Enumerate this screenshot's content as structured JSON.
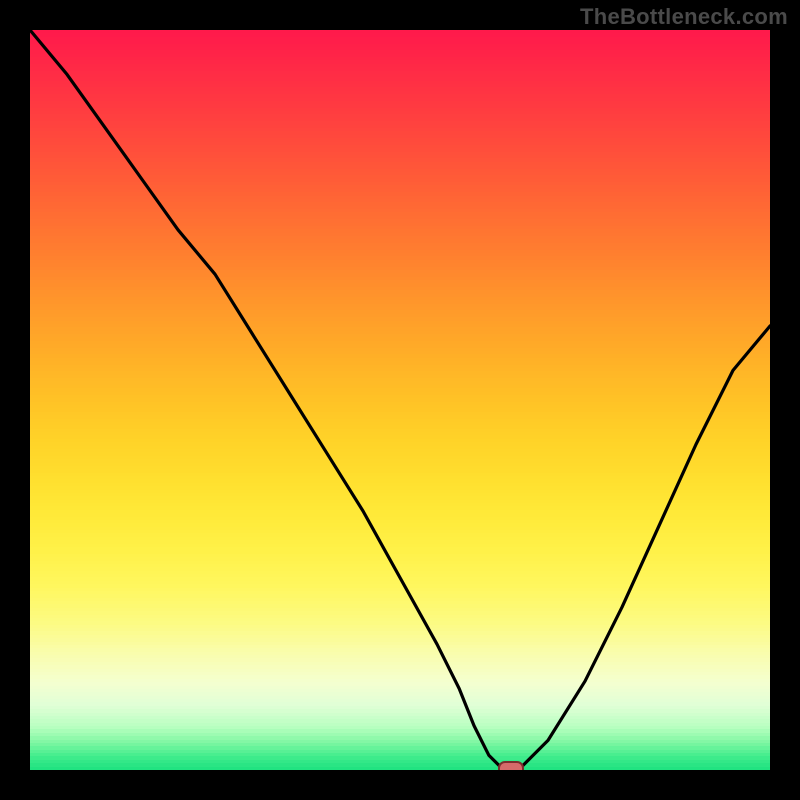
{
  "watermark": "TheBottleneck.com",
  "colors": {
    "black": "#000000",
    "curve": "#000000",
    "marker_fill": "#d66a6a",
    "marker_border": "#7a2e2e"
  },
  "chart_data": {
    "type": "line",
    "title": "",
    "xlabel": "",
    "ylabel": "",
    "xlim": [
      0,
      100
    ],
    "ylim": [
      0,
      100
    ],
    "series": [
      {
        "name": "bottleneck-curve",
        "x": [
          0,
          5,
          10,
          15,
          20,
          25,
          30,
          35,
          40,
          45,
          50,
          55,
          58,
          60,
          62,
          64,
          66,
          70,
          75,
          80,
          85,
          90,
          95,
          100
        ],
        "y": [
          100,
          94,
          87,
          80,
          73,
          67,
          59,
          51,
          43,
          35,
          26,
          17,
          11,
          6,
          2,
          0,
          0,
          4,
          12,
          22,
          33,
          44,
          54,
          60
        ]
      }
    ],
    "marker": {
      "x": 65,
      "y": 0
    },
    "gradient_stops": [
      {
        "p": 0.0,
        "c": "#ff1a4b"
      },
      {
        "p": 0.05,
        "c": "#ff2a46"
      },
      {
        "p": 0.1,
        "c": "#ff3a41"
      },
      {
        "p": 0.15,
        "c": "#ff4b3c"
      },
      {
        "p": 0.2,
        "c": "#ff5c37"
      },
      {
        "p": 0.25,
        "c": "#ff6e33"
      },
      {
        "p": 0.3,
        "c": "#ff7f2f"
      },
      {
        "p": 0.35,
        "c": "#ff912c"
      },
      {
        "p": 0.4,
        "c": "#ffa229"
      },
      {
        "p": 0.45,
        "c": "#ffb327"
      },
      {
        "p": 0.5,
        "c": "#ffc326"
      },
      {
        "p": 0.55,
        "c": "#ffd228"
      },
      {
        "p": 0.6,
        "c": "#ffde2e"
      },
      {
        "p": 0.65,
        "c": "#ffe938"
      },
      {
        "p": 0.7,
        "c": "#fff148"
      },
      {
        "p": 0.75,
        "c": "#fff75f"
      },
      {
        "p": 0.8,
        "c": "#fcfb84"
      },
      {
        "p": 0.84,
        "c": "#f9fdad"
      },
      {
        "p": 0.88,
        "c": "#f4ffd0"
      },
      {
        "p": 0.91,
        "c": "#e0ffd6"
      },
      {
        "p": 0.94,
        "c": "#b8ffc0"
      },
      {
        "p": 0.96,
        "c": "#80f7a3"
      },
      {
        "p": 0.98,
        "c": "#40ec8c"
      },
      {
        "p": 1.0,
        "c": "#18e07e"
      }
    ]
  }
}
